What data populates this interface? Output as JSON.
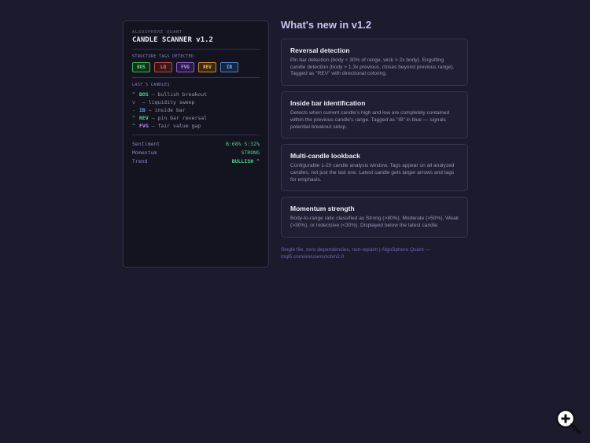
{
  "panel": {
    "brand": "ALGOSPHERE QUANT",
    "title": "CANDLE SCANNER v1.2",
    "tags_heading": "STRUCTURE TAGS DETECTED",
    "tags": [
      "BOS",
      "LQ",
      "FVG",
      "REV",
      "IB"
    ],
    "candles_heading": "LAST 5 CANDLES",
    "candles": [
      {
        "arrow": "^",
        "tag": "BOS",
        "desc": " — bullish breakout"
      },
      {
        "arrow": "v",
        "tag": "",
        "desc": "  — liquidity sweep"
      },
      {
        "arrow": "-",
        "tag": "IB",
        "desc": " — inside bar"
      },
      {
        "arrow": "^",
        "tag": "REV",
        "desc": " — pin bar reversal"
      },
      {
        "arrow": "^",
        "tag": "FVG",
        "desc": " — fair value gap"
      }
    ],
    "stats": [
      {
        "label": "Sentiment",
        "value": "B:68% S:32%"
      },
      {
        "label": "Momentum",
        "value": "STRONG"
      },
      {
        "label": "Trend",
        "value": "BULLISH ^"
      }
    ]
  },
  "main": {
    "title": "What's new in v1.2",
    "cards": [
      {
        "title": "Reversal detection",
        "desc": "Pin bar detection (body < 30% of range, wick > 2x body). Engulfing candle detection (body > 1.3x previous, closes beyond previous range). Tagged as \"REV\" with directional coloring."
      },
      {
        "title": "Inside bar identification",
        "desc": "Detects when current candle's high and low are completely contained within the previous candle's range. Tagged as \"IB\" in blue — signals potential breakout setup."
      },
      {
        "title": "Multi-candle lookback",
        "desc": "Configurable 1-20 candle analysis window. Tags appear on all analyzed candles, not just the last one. Latest candle gets larger arrows and tags for emphasis."
      },
      {
        "title": "Momentum strength",
        "desc": "Body-to-range ratio classified as Strong (>80%), Moderate (>50%), Weak (>30%), or Indecisive (<30%). Displayed below the latest candle."
      }
    ],
    "footer": "Single file, zero dependencies, non-repaint | AlgoSphere Quant — mql5.com/en/users/robin2.0"
  },
  "colors": {
    "background": "#1c1b2e",
    "panel": "#141320",
    "bullish": "#4fd68a",
    "bearish": "#f05a5a",
    "inside_bar": "#5aa8f0",
    "accent": "#c8c4f4"
  },
  "icons": {
    "zoom": "zoom-in-icon"
  }
}
